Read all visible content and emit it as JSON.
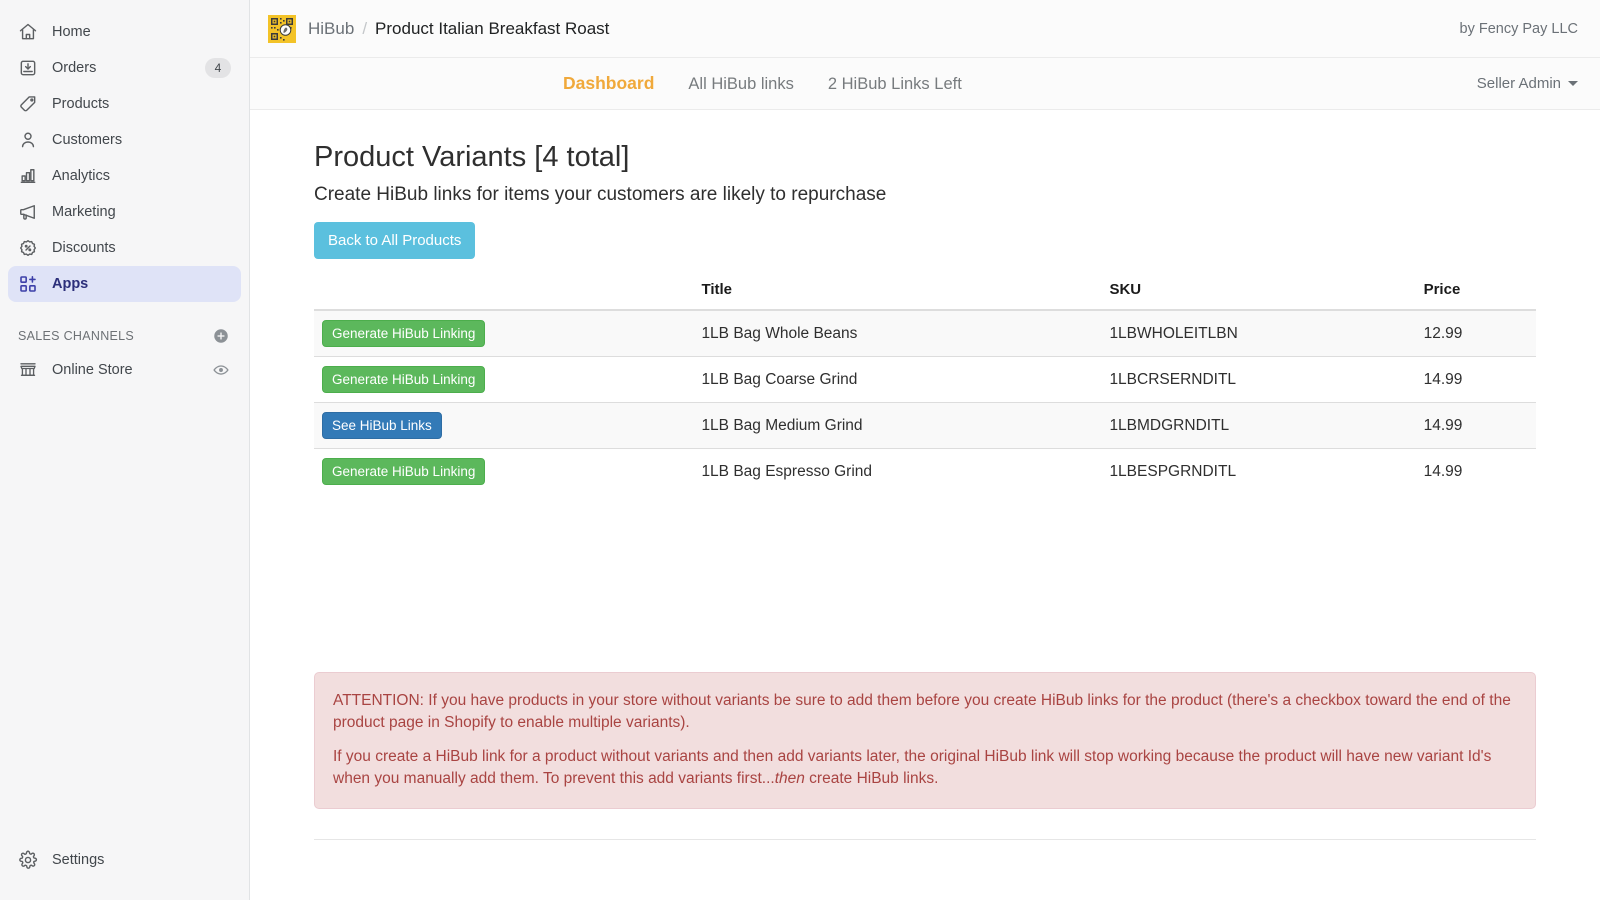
{
  "sidebar": {
    "items": [
      {
        "label": "Home",
        "icon": "home-icon",
        "badge": null,
        "active": false
      },
      {
        "label": "Orders",
        "icon": "orders-icon",
        "badge": "4",
        "active": false
      },
      {
        "label": "Products",
        "icon": "products-icon",
        "badge": null,
        "active": false
      },
      {
        "label": "Customers",
        "icon": "customers-icon",
        "badge": null,
        "active": false
      },
      {
        "label": "Analytics",
        "icon": "analytics-icon",
        "badge": null,
        "active": false
      },
      {
        "label": "Marketing",
        "icon": "marketing-icon",
        "badge": null,
        "active": false
      },
      {
        "label": "Discounts",
        "icon": "discounts-icon",
        "badge": null,
        "active": false
      },
      {
        "label": "Apps",
        "icon": "apps-icon",
        "badge": null,
        "active": true
      }
    ],
    "sales_channels": {
      "label": "SALES CHANNELS",
      "add_icon": "plus-circle-icon",
      "items": [
        {
          "label": "Online Store",
          "icon": "storefront-icon",
          "trailing_icon": "eye-icon"
        }
      ]
    },
    "settings": {
      "label": "Settings",
      "icon": "gear-icon"
    }
  },
  "header": {
    "app_icon": "qr-code-app-icon",
    "breadcrumb_root": "HiBub",
    "breadcrumb_separator": "/",
    "breadcrumb_current": "Product Italian Breakfast Roast",
    "byline": "by Fency Pay LLC"
  },
  "tabs": [
    {
      "label": "Dashboard",
      "active": true
    },
    {
      "label": "All HiBub links",
      "active": false
    },
    {
      "label": "2 HiBub Links Left",
      "active": false
    }
  ],
  "user_menu": {
    "label": "Seller Admin",
    "caret_icon": "caret-down-icon"
  },
  "main": {
    "title": "Product Variants [4 total]",
    "subtitle": "Create HiBub links for items your customers are likely to repurchase",
    "back_button": "Back to All Products",
    "table": {
      "columns": [
        "",
        "Title",
        "SKU",
        "Price"
      ],
      "rows": [
        {
          "action_label": "Generate HiBub Linking",
          "action_style": "success",
          "title": "1LB Bag Whole Beans",
          "sku": "1LBWHOLEITLBN",
          "price": "12.99"
        },
        {
          "action_label": "Generate HiBub Linking",
          "action_style": "success",
          "title": "1LB Bag Coarse Grind",
          "sku": "1LBCRSERNDITL",
          "price": "14.99"
        },
        {
          "action_label": "See HiBub Links",
          "action_style": "primary",
          "title": "1LB Bag Medium Grind",
          "sku": "1LBMDGRNDITL",
          "price": "14.99"
        },
        {
          "action_label": "Generate HiBub Linking",
          "action_style": "success",
          "title": "1LB Bag Espresso Grind",
          "sku": "1LBESPGRNDITL",
          "price": "14.99"
        }
      ]
    },
    "alert": {
      "paragraph_1": "ATTENTION: If you have products in your store without variants be sure to add them before you create HiBub links for the product (there's a checkbox toward the end of the product page in Shopify to enable multiple variants).",
      "paragraph_2_a": "If you create a HiBub link for a product without variants and then add variants later, the original HiBub link will stop working because the product will have new variant Id's when you manually add them. To prevent this add variants first...",
      "paragraph_2_em": "then",
      "paragraph_2_b": " create HiBub links."
    }
  },
  "colors": {
    "accent_orange": "#f0a93b",
    "btn_success": "#5cb85c",
    "btn_primary": "#337ab7",
    "btn_info": "#5bc0de",
    "alert_bg": "#f2dede",
    "alert_text": "#a94442",
    "sidebar_bg": "#f6f6f7",
    "sidebar_active_bg": "#dfe3f7",
    "app_icon_bg": "#f3c328"
  }
}
